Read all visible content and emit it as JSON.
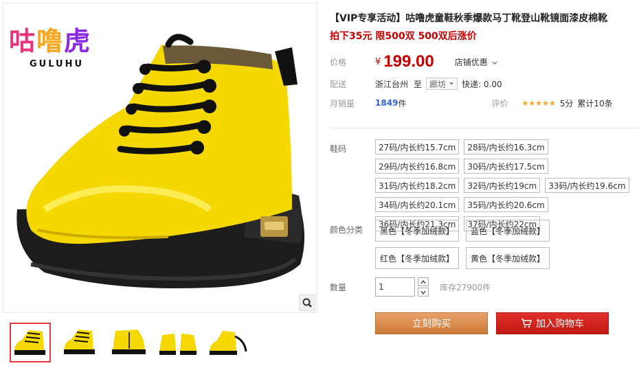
{
  "brand": {
    "name_cn": "咕噜虎",
    "name_en": "GULUHU",
    "chars": [
      {
        "ch": "咕",
        "color": "#e8327a"
      },
      {
        "ch": "噜",
        "color": "#f5a623"
      },
      {
        "ch": "虎",
        "color": "#8a2be2"
      }
    ]
  },
  "product": {
    "title": "【VIP专享活动】咕噜虎童鞋秋季爆款马丁靴登山靴镜面漆皮棉靴",
    "subtitle": "拍下35元 限500双 500双后涨价"
  },
  "price": {
    "label": "价格",
    "symbol": "¥",
    "value": "199.00",
    "promo": "店铺优惠"
  },
  "shipping": {
    "label": "配送",
    "from": "浙江台州",
    "to_word": "至",
    "dest": "廊坊",
    "express": "快递: 0.00"
  },
  "sales": {
    "label": "月销量",
    "count": "1849",
    "unit": "件",
    "rating_label": "评价",
    "stars": "★★★★★",
    "score": "5分",
    "reviews": "累计10条"
  },
  "size": {
    "label": "鞋码",
    "options": [
      "27码/内长约15.7cm",
      "28码/内长约16.3cm",
      "29码/内长约16.8cm",
      "30码/内长约17.5cm",
      "31码/内长约18.2cm",
      "32码/内长约19cm",
      "33码/内长约19.6cm",
      "34码/内长约20.1cm",
      "35码/内长约20.6cm",
      "36码/内长约21.3cm",
      "37码/内长约22cm"
    ]
  },
  "color": {
    "label": "颜色分类",
    "options": [
      "黑色【冬季加绒款】",
      "蓝色【冬季加绒款】",
      "红色【冬季加绒款】",
      "黄色【冬季加绒款】"
    ]
  },
  "quantity": {
    "label": "数量",
    "value": "1",
    "stock": "库存27900件"
  },
  "actions": {
    "buy": "立刻购买",
    "cart": "加入购物车"
  },
  "theme": {
    "accent": "#c40000",
    "link": "#3366cc",
    "boot_yellow": "#f5d800"
  },
  "icons": [
    "zoom-icon",
    "chevron-down-icon",
    "cart-icon",
    "up-arrow-icon",
    "down-arrow-icon"
  ]
}
